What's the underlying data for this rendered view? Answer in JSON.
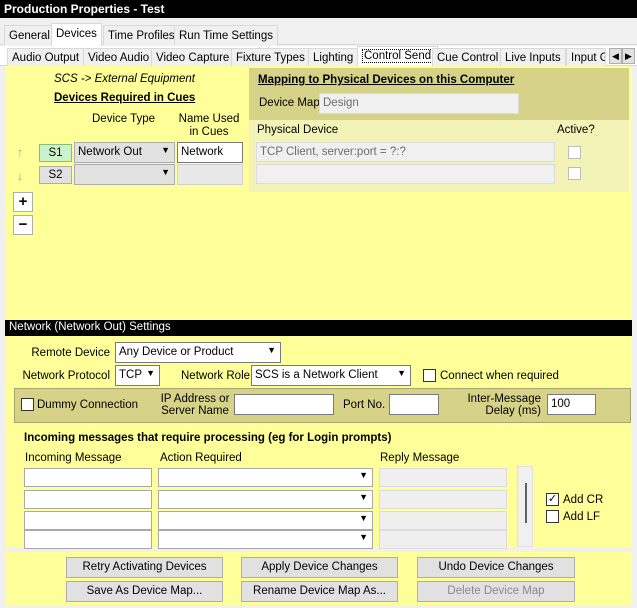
{
  "window": {
    "title": "Production Properties - Test"
  },
  "top_tabs": [
    "General",
    "Devices",
    "Time Profiles",
    "Run Time Settings"
  ],
  "sub_tabs": [
    "Audio Output",
    "Video Audio",
    "Video Capture",
    "Fixture Types",
    "Lighting",
    "Control Send",
    "Cue Control",
    "Live Inputs",
    "Input G"
  ],
  "devices": {
    "direction_label": "SCS -> External Equipment",
    "required_label": "Devices Required in Cues",
    "col_device_type": "Device Type",
    "col_name_used": "Name Used in Cues",
    "rows": [
      {
        "id": "S1",
        "type": "Network Out",
        "name": "Network"
      },
      {
        "id": "S2",
        "type": "",
        "name": ""
      }
    ],
    "add_glyph": "+",
    "remove_glyph": "−",
    "up_glyph": "↑",
    "down_glyph": "↓"
  },
  "mapping": {
    "title": "Mapping to Physical Devices on this Computer",
    "device_map_label": "Device Map",
    "device_map_value": "Design",
    "col_physical": "Physical Device",
    "col_active": "Active?",
    "rows": [
      "TCP Client, server:port = ?:?",
      ""
    ]
  },
  "network": {
    "section_title": "Network (Network Out) Settings",
    "remote_device_label": "Remote Device",
    "remote_device_value": "Any Device or Product",
    "protocol_label": "Network Protocol",
    "protocol_value": "TCP",
    "role_label": "Network Role",
    "role_value": "SCS is a Network Client",
    "connect_when_required": "Connect when required",
    "dummy_connection": "Dummy Connection",
    "ip_label_1": "IP Address or",
    "ip_label_2": "Server Name",
    "port_label": "Port No.",
    "delay_label_1": "Inter-Message",
    "delay_label_2": "Delay (ms)",
    "delay_value": "100",
    "incoming_title": "Incoming messages that require processing (eg for Login prompts)",
    "col_incoming": "Incoming Message",
    "col_action": "Action Required",
    "col_reply": "Reply Message",
    "add_cr": "Add CR",
    "add_lf": "Add LF"
  },
  "buttons": {
    "retry": "Retry Activating Devices",
    "apply": "Apply Device Changes",
    "undo": "Undo Device Changes",
    "save_as": "Save As Device Map...",
    "rename": "Rename Device Map As...",
    "delete": "Delete Device Map"
  },
  "checks": {
    "add_cr": true,
    "add_lf": false,
    "connect_when_required": false,
    "dummy_connection": false
  }
}
